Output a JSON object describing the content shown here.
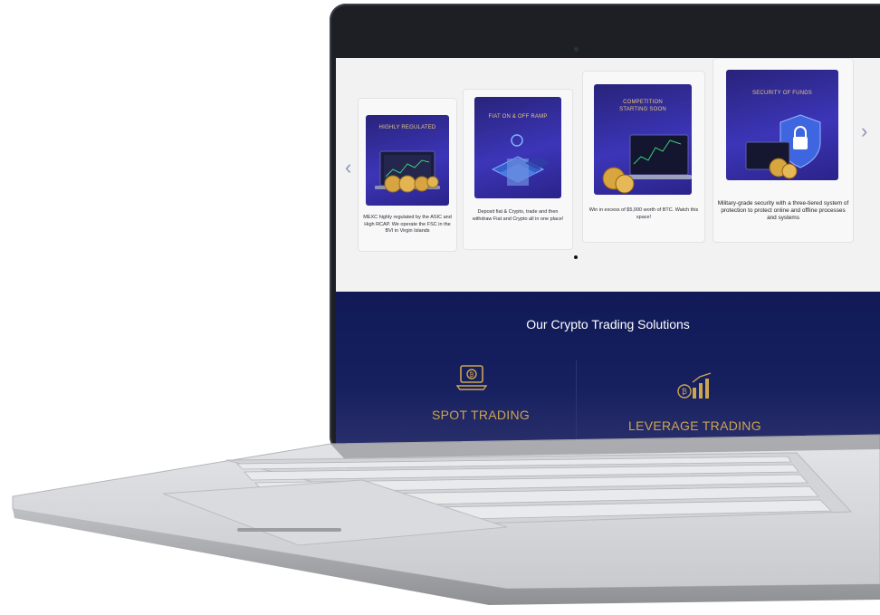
{
  "carousel": {
    "prev_icon": "chevron-left-icon",
    "next_icon": "chevron-right-icon",
    "cards": [
      {
        "title": "HIGHLY REGULATED",
        "text": "MEXC highly regulated by the ASIC and High RCAP. We operate the FSC in the BVI in Virgin Islands"
      },
      {
        "title": "FIAT ON & OFF RAMP",
        "text": "Deposit fiat & Crypto, trade and then withdraw Fiat and Crypto all in one place!"
      },
      {
        "title": "COMPETITION\nSTARTING SOON",
        "text": "Win in excess of $5,000 worth of BTC. Watch this space!"
      },
      {
        "title": "SECURITY OF FUNDS",
        "text": "Military-grade security with a three-tiered system of protection to protect online and offline processes and systems"
      }
    ]
  },
  "solutions": {
    "title": "Our Crypto Trading Solutions",
    "items": [
      {
        "label": "SPOT TRADING",
        "icon": "bitcoin-laptop-icon"
      },
      {
        "label": "LEVERAGE TRADING",
        "icon": "bitcoin-bar-chart-icon"
      }
    ]
  },
  "colors": {
    "accent": "#cda550",
    "navy": "#111a57",
    "card_bg": "#3c35b8"
  }
}
